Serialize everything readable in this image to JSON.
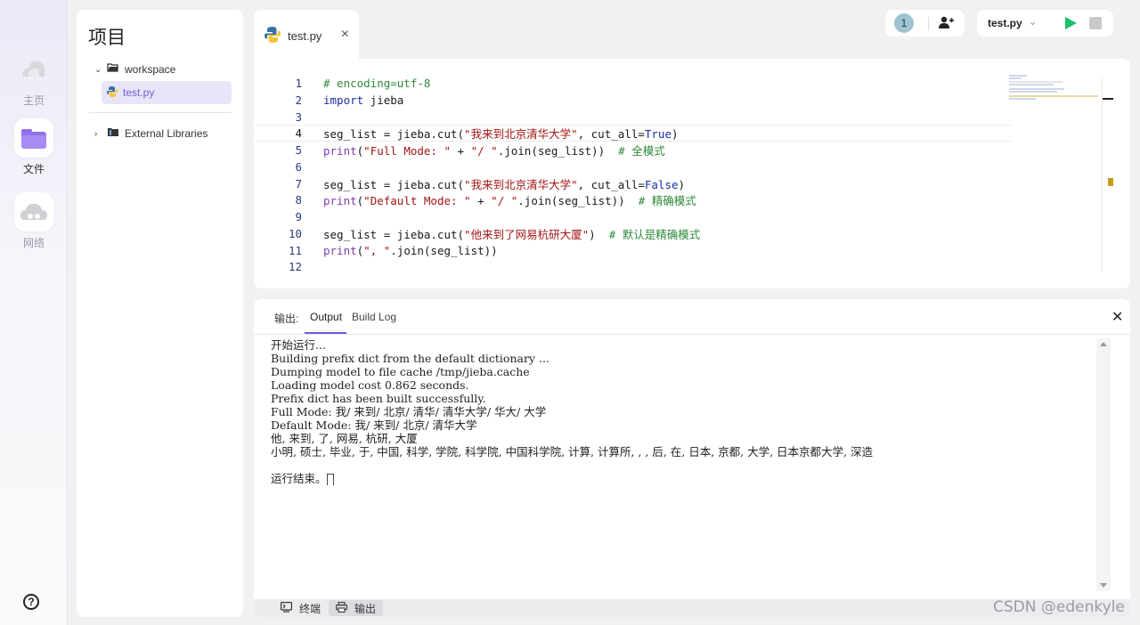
{
  "rail": {
    "home_label": "主页",
    "files_label": "文件",
    "network_label": "网络"
  },
  "project": {
    "title": "项目",
    "workspace": "workspace",
    "file": "test.py",
    "external": "External Libraries"
  },
  "editor": {
    "tab_label": "test.py",
    "lines": [
      "1",
      "2",
      "3",
      "4",
      "5",
      "6",
      "7",
      "8",
      "9",
      "10",
      "11",
      "12"
    ]
  },
  "toolbar": {
    "collaborator_count": "1",
    "run_target": "test.py"
  },
  "output": {
    "label": "输出:",
    "tab_output": "Output",
    "tab_build": "Build Log",
    "lines": [
      "开始运行...",
      "Building prefix dict from the default dictionary ...",
      "Dumping model to file cache /tmp/jieba.cache",
      "Loading model cost 0.862 seconds.",
      "Prefix dict has been built successfully.",
      "Full Mode: 我/ 来到/ 北京/ 清华/ 清华大学/ 华大/ 大学",
      "Default Mode: 我/ 来到/ 北京/ 清华大学",
      "他, 来到, 了, 网易, 杭研, 大厦",
      "小明, 硕士, 毕业, 于, 中国, 科学, 学院, 科学院, 中国科学院, 计算, 计算所, , , 后, 在, 日本, 京都, 大学, 日本京都大学, 深造",
      "",
      "运行结束。"
    ]
  },
  "bottom": {
    "terminal": "终端",
    "output": "输出"
  },
  "watermark": "CSDN @edenkyle",
  "colors": {
    "accent": "#6e5cd6",
    "run": "#18c06a"
  }
}
